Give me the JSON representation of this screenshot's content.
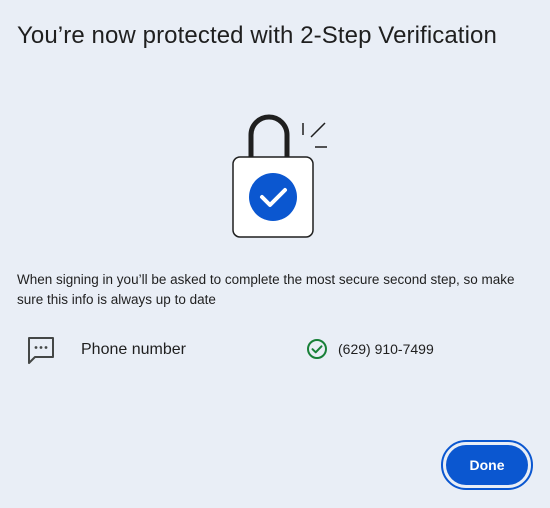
{
  "dialog": {
    "title": "You’re now protected with 2-Step Verification",
    "body": "When signing in you’ll be asked to complete the most secure second step, so make sure this info is always up to date",
    "illustration": "padlock-with-check-icon",
    "method": {
      "icon": "sms-icon",
      "label": "Phone number",
      "status_icon": "check-circle-icon",
      "value": "(629) 910-7499"
    },
    "done_button": "Done"
  },
  "colors": {
    "background": "#e9eef6",
    "accent": "#0b57d0",
    "success": "#188038",
    "text": "#1f1f1f"
  }
}
